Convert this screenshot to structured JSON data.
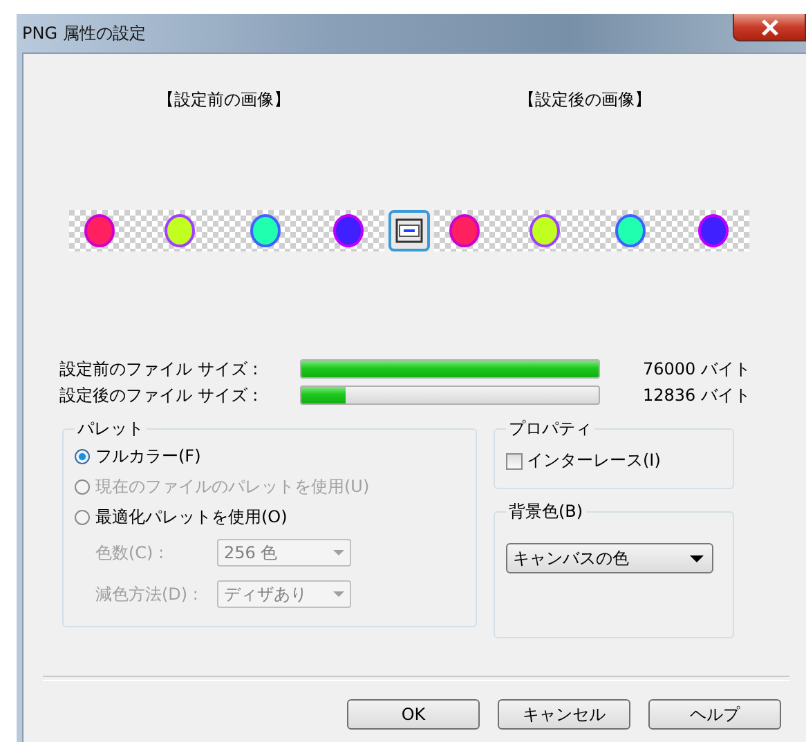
{
  "window": {
    "title": "PNG 属性の設定"
  },
  "preview": {
    "before_label": "【設定前の画像】",
    "after_label": "【設定後の画像】"
  },
  "sizes": [
    {
      "label": "設定前のファイル サイズ :",
      "level": 1.0,
      "reading": "76000 バイト"
    },
    {
      "label": "設定後のファイル サイズ :",
      "level": 0.15,
      "reading": "12836 バイト"
    }
  ],
  "palette": {
    "title": "パレット",
    "options": [
      {
        "label": "フルカラー(F)",
        "selected": true,
        "disabled": false
      },
      {
        "label": "現在のファイルのパレットを使用(U)",
        "selected": false,
        "disabled": true
      },
      {
        "label": "最適化パレットを使用(O)",
        "selected": false,
        "disabled": false
      }
    ],
    "fields": [
      {
        "label": "色数(C) :",
        "value": "256 色",
        "disabled": true
      },
      {
        "label": "減色方法(D) :",
        "value": "ディザあり",
        "disabled": true
      }
    ]
  },
  "properties": {
    "title": "プロパティ",
    "interlace": {
      "label": "インターレース(I)",
      "checked": false
    }
  },
  "background": {
    "title": "背景色(B)",
    "value": "キャンバスの色"
  },
  "buttons": [
    {
      "label": "OK"
    },
    {
      "label": "キャンセル"
    },
    {
      "label": "ヘルプ"
    }
  ]
}
